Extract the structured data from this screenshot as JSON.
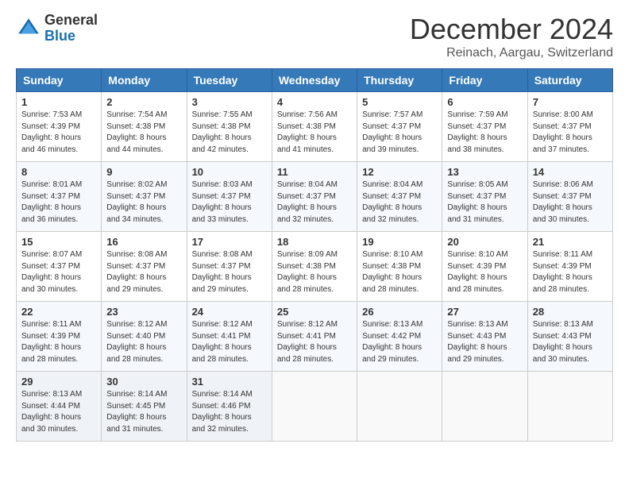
{
  "header": {
    "logo_general": "General",
    "logo_blue": "Blue",
    "month": "December 2024",
    "location": "Reinach, Aargau, Switzerland"
  },
  "days_of_week": [
    "Sunday",
    "Monday",
    "Tuesday",
    "Wednesday",
    "Thursday",
    "Friday",
    "Saturday"
  ],
  "weeks": [
    [
      {
        "day": "1",
        "sunrise": "Sunrise: 7:53 AM",
        "sunset": "Sunset: 4:39 PM",
        "daylight": "Daylight: 8 hours and 46 minutes."
      },
      {
        "day": "2",
        "sunrise": "Sunrise: 7:54 AM",
        "sunset": "Sunset: 4:38 PM",
        "daylight": "Daylight: 8 hours and 44 minutes."
      },
      {
        "day": "3",
        "sunrise": "Sunrise: 7:55 AM",
        "sunset": "Sunset: 4:38 PM",
        "daylight": "Daylight: 8 hours and 42 minutes."
      },
      {
        "day": "4",
        "sunrise": "Sunrise: 7:56 AM",
        "sunset": "Sunset: 4:38 PM",
        "daylight": "Daylight: 8 hours and 41 minutes."
      },
      {
        "day": "5",
        "sunrise": "Sunrise: 7:57 AM",
        "sunset": "Sunset: 4:37 PM",
        "daylight": "Daylight: 8 hours and 39 minutes."
      },
      {
        "day": "6",
        "sunrise": "Sunrise: 7:59 AM",
        "sunset": "Sunset: 4:37 PM",
        "daylight": "Daylight: 8 hours and 38 minutes."
      },
      {
        "day": "7",
        "sunrise": "Sunrise: 8:00 AM",
        "sunset": "Sunset: 4:37 PM",
        "daylight": "Daylight: 8 hours and 37 minutes."
      }
    ],
    [
      {
        "day": "8",
        "sunrise": "Sunrise: 8:01 AM",
        "sunset": "Sunset: 4:37 PM",
        "daylight": "Daylight: 8 hours and 36 minutes."
      },
      {
        "day": "9",
        "sunrise": "Sunrise: 8:02 AM",
        "sunset": "Sunset: 4:37 PM",
        "daylight": "Daylight: 8 hours and 34 minutes."
      },
      {
        "day": "10",
        "sunrise": "Sunrise: 8:03 AM",
        "sunset": "Sunset: 4:37 PM",
        "daylight": "Daylight: 8 hours and 33 minutes."
      },
      {
        "day": "11",
        "sunrise": "Sunrise: 8:04 AM",
        "sunset": "Sunset: 4:37 PM",
        "daylight": "Daylight: 8 hours and 32 minutes."
      },
      {
        "day": "12",
        "sunrise": "Sunrise: 8:04 AM",
        "sunset": "Sunset: 4:37 PM",
        "daylight": "Daylight: 8 hours and 32 minutes."
      },
      {
        "day": "13",
        "sunrise": "Sunrise: 8:05 AM",
        "sunset": "Sunset: 4:37 PM",
        "daylight": "Daylight: 8 hours and 31 minutes."
      },
      {
        "day": "14",
        "sunrise": "Sunrise: 8:06 AM",
        "sunset": "Sunset: 4:37 PM",
        "daylight": "Daylight: 8 hours and 30 minutes."
      }
    ],
    [
      {
        "day": "15",
        "sunrise": "Sunrise: 8:07 AM",
        "sunset": "Sunset: 4:37 PM",
        "daylight": "Daylight: 8 hours and 30 minutes."
      },
      {
        "day": "16",
        "sunrise": "Sunrise: 8:08 AM",
        "sunset": "Sunset: 4:37 PM",
        "daylight": "Daylight: 8 hours and 29 minutes."
      },
      {
        "day": "17",
        "sunrise": "Sunrise: 8:08 AM",
        "sunset": "Sunset: 4:37 PM",
        "daylight": "Daylight: 8 hours and 29 minutes."
      },
      {
        "day": "18",
        "sunrise": "Sunrise: 8:09 AM",
        "sunset": "Sunset: 4:38 PM",
        "daylight": "Daylight: 8 hours and 28 minutes."
      },
      {
        "day": "19",
        "sunrise": "Sunrise: 8:10 AM",
        "sunset": "Sunset: 4:38 PM",
        "daylight": "Daylight: 8 hours and 28 minutes."
      },
      {
        "day": "20",
        "sunrise": "Sunrise: 8:10 AM",
        "sunset": "Sunset: 4:39 PM",
        "daylight": "Daylight: 8 hours and 28 minutes."
      },
      {
        "day": "21",
        "sunrise": "Sunrise: 8:11 AM",
        "sunset": "Sunset: 4:39 PM",
        "daylight": "Daylight: 8 hours and 28 minutes."
      }
    ],
    [
      {
        "day": "22",
        "sunrise": "Sunrise: 8:11 AM",
        "sunset": "Sunset: 4:39 PM",
        "daylight": "Daylight: 8 hours and 28 minutes."
      },
      {
        "day": "23",
        "sunrise": "Sunrise: 8:12 AM",
        "sunset": "Sunset: 4:40 PM",
        "daylight": "Daylight: 8 hours and 28 minutes."
      },
      {
        "day": "24",
        "sunrise": "Sunrise: 8:12 AM",
        "sunset": "Sunset: 4:41 PM",
        "daylight": "Daylight: 8 hours and 28 minutes."
      },
      {
        "day": "25",
        "sunrise": "Sunrise: 8:12 AM",
        "sunset": "Sunset: 4:41 PM",
        "daylight": "Daylight: 8 hours and 28 minutes."
      },
      {
        "day": "26",
        "sunrise": "Sunrise: 8:13 AM",
        "sunset": "Sunset: 4:42 PM",
        "daylight": "Daylight: 8 hours and 29 minutes."
      },
      {
        "day": "27",
        "sunrise": "Sunrise: 8:13 AM",
        "sunset": "Sunset: 4:43 PM",
        "daylight": "Daylight: 8 hours and 29 minutes."
      },
      {
        "day": "28",
        "sunrise": "Sunrise: 8:13 AM",
        "sunset": "Sunset: 4:43 PM",
        "daylight": "Daylight: 8 hours and 30 minutes."
      }
    ],
    [
      {
        "day": "29",
        "sunrise": "Sunrise: 8:13 AM",
        "sunset": "Sunset: 4:44 PM",
        "daylight": "Daylight: 8 hours and 30 minutes."
      },
      {
        "day": "30",
        "sunrise": "Sunrise: 8:14 AM",
        "sunset": "Sunset: 4:45 PM",
        "daylight": "Daylight: 8 hours and 31 minutes."
      },
      {
        "day": "31",
        "sunrise": "Sunrise: 8:14 AM",
        "sunset": "Sunset: 4:46 PM",
        "daylight": "Daylight: 8 hours and 32 minutes."
      },
      null,
      null,
      null,
      null
    ]
  ]
}
